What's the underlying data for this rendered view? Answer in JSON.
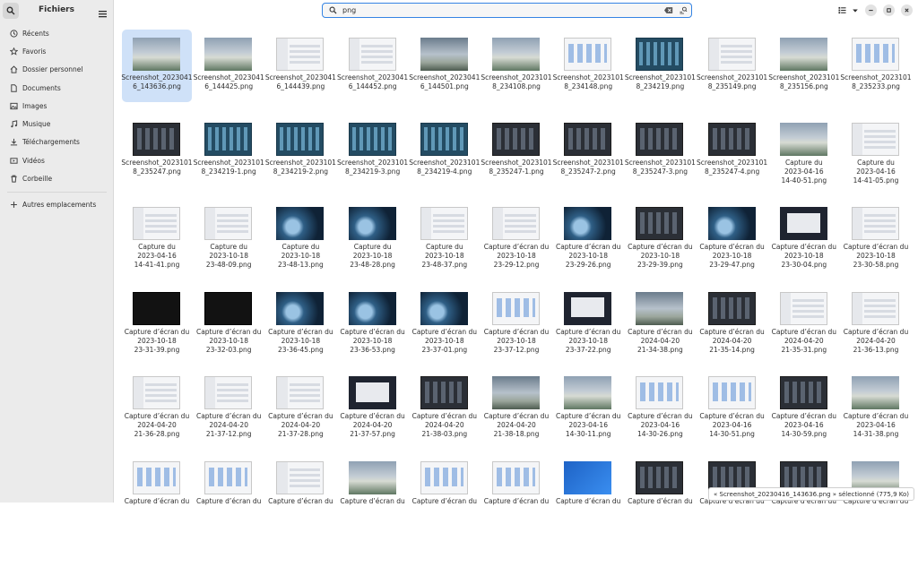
{
  "sidebar": {
    "title": "Fichiers",
    "items": [
      {
        "label": "Récents",
        "icon": "clock-icon"
      },
      {
        "label": "Favoris",
        "icon": "star-icon"
      },
      {
        "label": "Dossier personnel",
        "icon": "home-icon"
      },
      {
        "label": "Documents",
        "icon": "document-icon"
      },
      {
        "label": "Images",
        "icon": "image-icon"
      },
      {
        "label": "Musique",
        "icon": "music-icon"
      },
      {
        "label": "Téléchargements",
        "icon": "download-icon"
      },
      {
        "label": "Vidéos",
        "icon": "video-icon"
      },
      {
        "label": "Corbeille",
        "icon": "trash-icon"
      }
    ],
    "other_locations": "Autres emplacements"
  },
  "search": {
    "value": "png",
    "placeholder": ""
  },
  "status_bar": "« Screenshot_20230416_143636.png » sélectionné (775,9 Ko)",
  "files": [
    {
      "name": "Screenshot_20230416_143636.png",
      "lines": [
        "Screenshot_2023041",
        "6_143636.png"
      ],
      "thumb": "sky",
      "selected": true
    },
    {
      "name": "Screenshot_20230416_144425.png",
      "lines": [
        "Screenshot_2023041",
        "6_144425.png"
      ],
      "thumb": "sky"
    },
    {
      "name": "Screenshot_20230416_144439.png",
      "lines": [
        "Screenshot_2023041",
        "6_144439.png"
      ],
      "thumb": "ui"
    },
    {
      "name": "Screenshot_20230416_144452.png",
      "lines": [
        "Screenshot_2023041",
        "6_144452.png"
      ],
      "thumb": "ui"
    },
    {
      "name": "Screenshot_20230416_144501.png",
      "lines": [
        "Screenshot_2023041",
        "6_144501.png"
      ],
      "thumb": "sky2"
    },
    {
      "name": "Screenshot_20231018_234108.png",
      "lines": [
        "Screenshot_2023101",
        "8_234108.png"
      ],
      "thumb": "sky"
    },
    {
      "name": "Screenshot_20231018_234148.png",
      "lines": [
        "Screenshot_2023101",
        "8_234148.png"
      ],
      "thumb": "uib"
    },
    {
      "name": "Screenshot_20231018_234219.png",
      "lines": [
        "Screenshot_2023101",
        "8_234219.png"
      ],
      "thumb": "teal"
    },
    {
      "name": "Screenshot_20231018_235149.png",
      "lines": [
        "Screenshot_2023101",
        "8_235149.png"
      ],
      "thumb": "ui"
    },
    {
      "name": "Screenshot_20231018_235156.png",
      "lines": [
        "Screenshot_2023101",
        "8_235156.png"
      ],
      "thumb": "sky"
    },
    {
      "name": "Screenshot_20231018_235233.png",
      "lines": [
        "Screenshot_2023101",
        "8_235233.png"
      ],
      "thumb": "uib"
    },
    {
      "name": "Screenshot_20231018_235247.png",
      "lines": [
        "Screenshot_2023101",
        "8_235247.png"
      ],
      "thumb": "dark"
    },
    {
      "name": "Screenshot_20231018_234219-1.png",
      "lines": [
        "Screenshot_2023101",
        "8_234219-1.png"
      ],
      "thumb": "teal"
    },
    {
      "name": "Screenshot_20231018_234219-2.png",
      "lines": [
        "Screenshot_2023101",
        "8_234219-2.png"
      ],
      "thumb": "teal"
    },
    {
      "name": "Screenshot_20231018_234219-3.png",
      "lines": [
        "Screenshot_2023101",
        "8_234219-3.png"
      ],
      "thumb": "teal"
    },
    {
      "name": "Screenshot_20231018_234219-4.png",
      "lines": [
        "Screenshot_2023101",
        "8_234219-4.png"
      ],
      "thumb": "teal"
    },
    {
      "name": "Screenshot_20231018_235247-1.png",
      "lines": [
        "Screenshot_2023101",
        "8_235247-1.png"
      ],
      "thumb": "dark"
    },
    {
      "name": "Screenshot_20231018_235247-2.png",
      "lines": [
        "Screenshot_2023101",
        "8_235247-2.png"
      ],
      "thumb": "dark"
    },
    {
      "name": "Screenshot_20231018_235247-3.png",
      "lines": [
        "Screenshot_2023101",
        "8_235247-3.png"
      ],
      "thumb": "dark"
    },
    {
      "name": "Screenshot_20231018_235247-4.png",
      "lines": [
        "Screenshot_2023101",
        "8_235247-4.png"
      ],
      "thumb": "dark"
    },
    {
      "name": "Capture du 2023-04-16 14-40-51.png",
      "lines": [
        "Capture du",
        "2023-04-16",
        "14-40-51.png"
      ],
      "thumb": "sky"
    },
    {
      "name": "Capture du 2023-04-16 14-41-05.png",
      "lines": [
        "Capture du",
        "2023-04-16",
        "14-41-05.png"
      ],
      "thumb": "ui"
    },
    {
      "name": "Capture du 2023-04-16 14-41-41.png",
      "lines": [
        "Capture du",
        "2023-04-16",
        "14-41-41.png"
      ],
      "thumb": "ui"
    },
    {
      "name": "Capture du 2023-10-18 23-48-09.png",
      "lines": [
        "Capture du",
        "2023-10-18",
        "23-48-09.png"
      ],
      "thumb": "ui"
    },
    {
      "name": "Capture du 2023-10-18 23-48-13.png",
      "lines": [
        "Capture du",
        "2023-10-18",
        "23-48-13.png"
      ],
      "thumb": "wave"
    },
    {
      "name": "Capture du 2023-10-18 23-48-28.png",
      "lines": [
        "Capture du",
        "2023-10-18",
        "23-48-28.png"
      ],
      "thumb": "wave"
    },
    {
      "name": "Capture du 2023-10-18 23-48-37.png",
      "lines": [
        "Capture du",
        "2023-10-18",
        "23-48-37.png"
      ],
      "thumb": "ui"
    },
    {
      "name": "Capture d’écran du 2023-10-18 23-29-12.png",
      "lines": [
        "Capture d’écran du",
        "2023-10-18",
        "23-29-12.png"
      ],
      "thumb": "ui"
    },
    {
      "name": "Capture d’écran du 2023-10-18 23-29-26.png",
      "lines": [
        "Capture d’écran du",
        "2023-10-18",
        "23-29-26.png"
      ],
      "thumb": "wave"
    },
    {
      "name": "Capture d’écran du 2023-10-18 23-29-39.png",
      "lines": [
        "Capture d’écran du",
        "2023-10-18",
        "23-29-39.png"
      ],
      "thumb": "dark"
    },
    {
      "name": "Capture d’écran du 2023-10-18 23-29-47.png",
      "lines": [
        "Capture d’écran du",
        "2023-10-18",
        "23-29-47.png"
      ],
      "thumb": "wave"
    },
    {
      "name": "Capture d’écran du 2023-10-18 23-30-04.png",
      "lines": [
        "Capture d’écran du",
        "2023-10-18",
        "23-30-04.png"
      ],
      "thumb": "win"
    },
    {
      "name": "Capture d’écran du 2023-10-18 23-30-58.png",
      "lines": [
        "Capture d’écran du",
        "2023-10-18",
        "23-30-58.png"
      ],
      "thumb": "ui"
    },
    {
      "name": "Capture d’écran du 2023-10-18 23-31-39.png",
      "lines": [
        "Capture d’écran du",
        "2023-10-18",
        "23-31-39.png"
      ],
      "thumb": "black"
    },
    {
      "name": "Capture d’écran du 2023-10-18 23-32-03.png",
      "lines": [
        "Capture d’écran du",
        "2023-10-18",
        "23-32-03.png"
      ],
      "thumb": "black"
    },
    {
      "name": "Capture d’écran du 2023-10-18 23-36-45.png",
      "lines": [
        "Capture d’écran du",
        "2023-10-18",
        "23-36-45.png"
      ],
      "thumb": "wave"
    },
    {
      "name": "Capture d’écran du 2023-10-18 23-36-53.png",
      "lines": [
        "Capture d’écran du",
        "2023-10-18",
        "23-36-53.png"
      ],
      "thumb": "wave"
    },
    {
      "name": "Capture d’écran du 2023-10-18 23-37-01.png",
      "lines": [
        "Capture d’écran du",
        "2023-10-18",
        "23-37-01.png"
      ],
      "thumb": "wave"
    },
    {
      "name": "Capture d’écran du 2023-10-18 23-37-12.png",
      "lines": [
        "Capture d’écran du",
        "2023-10-18",
        "23-37-12.png"
      ],
      "thumb": "uib"
    },
    {
      "name": "Capture d’écran du 2023-10-18 23-37-22.png",
      "lines": [
        "Capture d’écran du",
        "2023-10-18",
        "23-37-22.png"
      ],
      "thumb": "win"
    },
    {
      "name": "Capture d’écran du 2024-04-20 21-34-38.png",
      "lines": [
        "Capture d’écran du",
        "2024-04-20",
        "21-34-38.png"
      ],
      "thumb": "sky2"
    },
    {
      "name": "Capture d’écran du 2024-04-20 21-35-14.png",
      "lines": [
        "Capture d’écran du",
        "2024-04-20",
        "21-35-14.png"
      ],
      "thumb": "dark"
    },
    {
      "name": "Capture d’écran du 2024-04-20 21-35-31.png",
      "lines": [
        "Capture d’écran du",
        "2024-04-20",
        "21-35-31.png"
      ],
      "thumb": "ui"
    },
    {
      "name": "Capture d’écran du 2024-04-20 21-36-13.png",
      "lines": [
        "Capture d’écran du",
        "2024-04-20",
        "21-36-13.png"
      ],
      "thumb": "ui"
    },
    {
      "name": "Capture d’écran du 2024-04-20 21-36-28.png",
      "lines": [
        "Capture d’écran du",
        "2024-04-20",
        "21-36-28.png"
      ],
      "thumb": "ui"
    },
    {
      "name": "Capture d’écran du 2024-04-20 21-37-12.png",
      "lines": [
        "Capture d’écran du",
        "2024-04-20",
        "21-37-12.png"
      ],
      "thumb": "ui"
    },
    {
      "name": "Capture d’écran du 2024-04-20 21-37-28.png",
      "lines": [
        "Capture d’écran du",
        "2024-04-20",
        "21-37-28.png"
      ],
      "thumb": "ui"
    },
    {
      "name": "Capture d’écran du 2024-04-20 21-37-57.png",
      "lines": [
        "Capture d’écran du",
        "2024-04-20",
        "21-37-57.png"
      ],
      "thumb": "win"
    },
    {
      "name": "Capture d’écran du 2024-04-20 21-38-03.png",
      "lines": [
        "Capture d’écran du",
        "2024-04-20",
        "21-38-03.png"
      ],
      "thumb": "dark"
    },
    {
      "name": "Capture d’écran du 2024-04-20 21-38-18.png",
      "lines": [
        "Capture d’écran du",
        "2024-04-20",
        "21-38-18.png"
      ],
      "thumb": "sky2"
    },
    {
      "name": "Capture d’écran du 2023-04-16 14-30-11.png",
      "lines": [
        "Capture d’écran du",
        "2023-04-16",
        "14-30-11.png"
      ],
      "thumb": "sky"
    },
    {
      "name": "Capture d’écran du 2023-04-16 14-30-26.png",
      "lines": [
        "Capture d’écran du",
        "2023-04-16",
        "14-30-26.png"
      ],
      "thumb": "uib"
    },
    {
      "name": "Capture d’écran du 2023-04-16 14-30-51.png",
      "lines": [
        "Capture d’écran du",
        "2023-04-16",
        "14-30-51.png"
      ],
      "thumb": "uib"
    },
    {
      "name": "Capture d’écran du 2023-04-16 14-30-59.png",
      "lines": [
        "Capture d’écran du",
        "2023-04-16",
        "14-30-59.png"
      ],
      "thumb": "dark"
    },
    {
      "name": "Capture d’écran du 2023-04-16 14-31-38.png",
      "lines": [
        "Capture d’écran du",
        "2023-04-16",
        "14-31-38.png"
      ],
      "thumb": "sky"
    },
    {
      "name": "",
      "lines": [
        "Capture d’écran du"
      ],
      "thumb": "uib"
    },
    {
      "name": "",
      "lines": [
        "Capture d’écran du"
      ],
      "thumb": "uib"
    },
    {
      "name": "",
      "lines": [
        "Capture d’écran du"
      ],
      "thumb": "ui"
    },
    {
      "name": "",
      "lines": [
        "Capture d’écran du"
      ],
      "thumb": "sky"
    },
    {
      "name": "",
      "lines": [
        "Capture d’écran du"
      ],
      "thumb": "uib"
    },
    {
      "name": "",
      "lines": [
        "Capture d’écran du"
      ],
      "thumb": "uib"
    },
    {
      "name": "",
      "lines": [
        "Capture d’écran du"
      ],
      "thumb": "blue"
    },
    {
      "name": "",
      "lines": [
        "Capture d’écran du"
      ],
      "thumb": "dark"
    },
    {
      "name": "",
      "lines": [
        "Capture d’écran du"
      ],
      "thumb": "dark"
    },
    {
      "name": "",
      "lines": [
        "Capture d’écran du"
      ],
      "thumb": "dark"
    },
    {
      "name": "",
      "lines": [
        "Capture d’écran du"
      ],
      "thumb": "sky"
    }
  ],
  "colors": {
    "accent": "#3584e4",
    "selection": "#cfe1f8",
    "sidebar_bg": "#ebebeb"
  }
}
